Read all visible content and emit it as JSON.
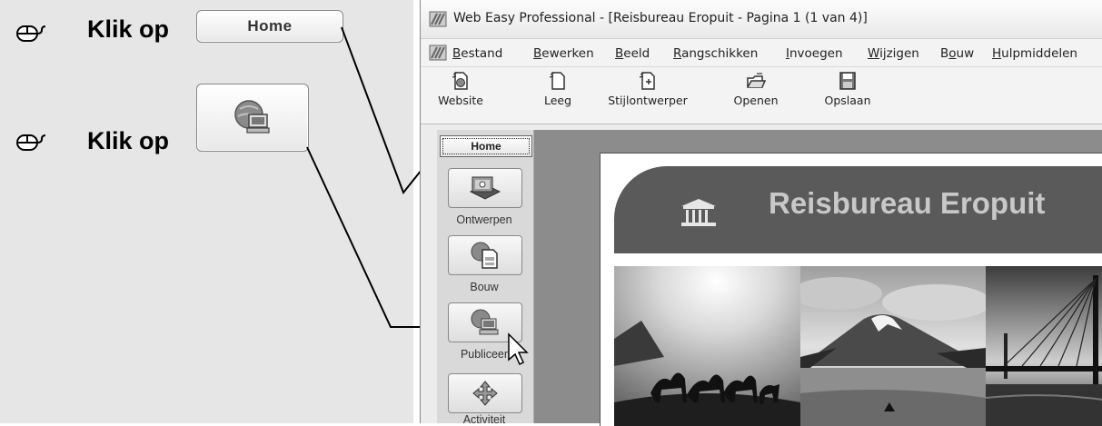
{
  "instructions": {
    "step1_text": "Klik op",
    "step1_button": "Home",
    "step2_text": "Klik op",
    "step2_button_icon": "publish-computer-icon"
  },
  "app": {
    "title": "Web Easy Professional - [Reisbureau Eropuit - Pagina 1 (1 van 4)]",
    "menu": [
      {
        "pre": "",
        "key": "B",
        "post": "estand"
      },
      {
        "pre": "",
        "key": "B",
        "post": "ewerken"
      },
      {
        "pre": "",
        "key": "B",
        "post": "eeld"
      },
      {
        "pre": "",
        "key": "R",
        "post": "angschikken"
      },
      {
        "pre": "",
        "key": "I",
        "post": "nvoegen"
      },
      {
        "pre": "",
        "key": "W",
        "post": "ijzigen"
      },
      {
        "pre": "B",
        "key": "o",
        "post": "uw"
      },
      {
        "pre": "",
        "key": "H",
        "post": "ulpmiddelen"
      }
    ],
    "toolbar": [
      "Website",
      "Leeg",
      "Stijlontwerper",
      "Openen",
      "Opslaan"
    ],
    "sidebar": {
      "home": "Home",
      "items": [
        "Ontwerpen",
        "Bouw",
        "Publiceer",
        "Activiteit"
      ]
    },
    "page": {
      "banner_title": "Reisbureau Eropuit",
      "photos": [
        "desert-camels-photo",
        "mount-fuji-lake-photo",
        "suspension-bridge-photo"
      ]
    }
  },
  "colors": {
    "instruction_bg": "#e6e6e6",
    "canvas_bg": "#8c8c8c",
    "banner_bg": "#5a5a5a",
    "banner_text": "#c8c8c8"
  }
}
